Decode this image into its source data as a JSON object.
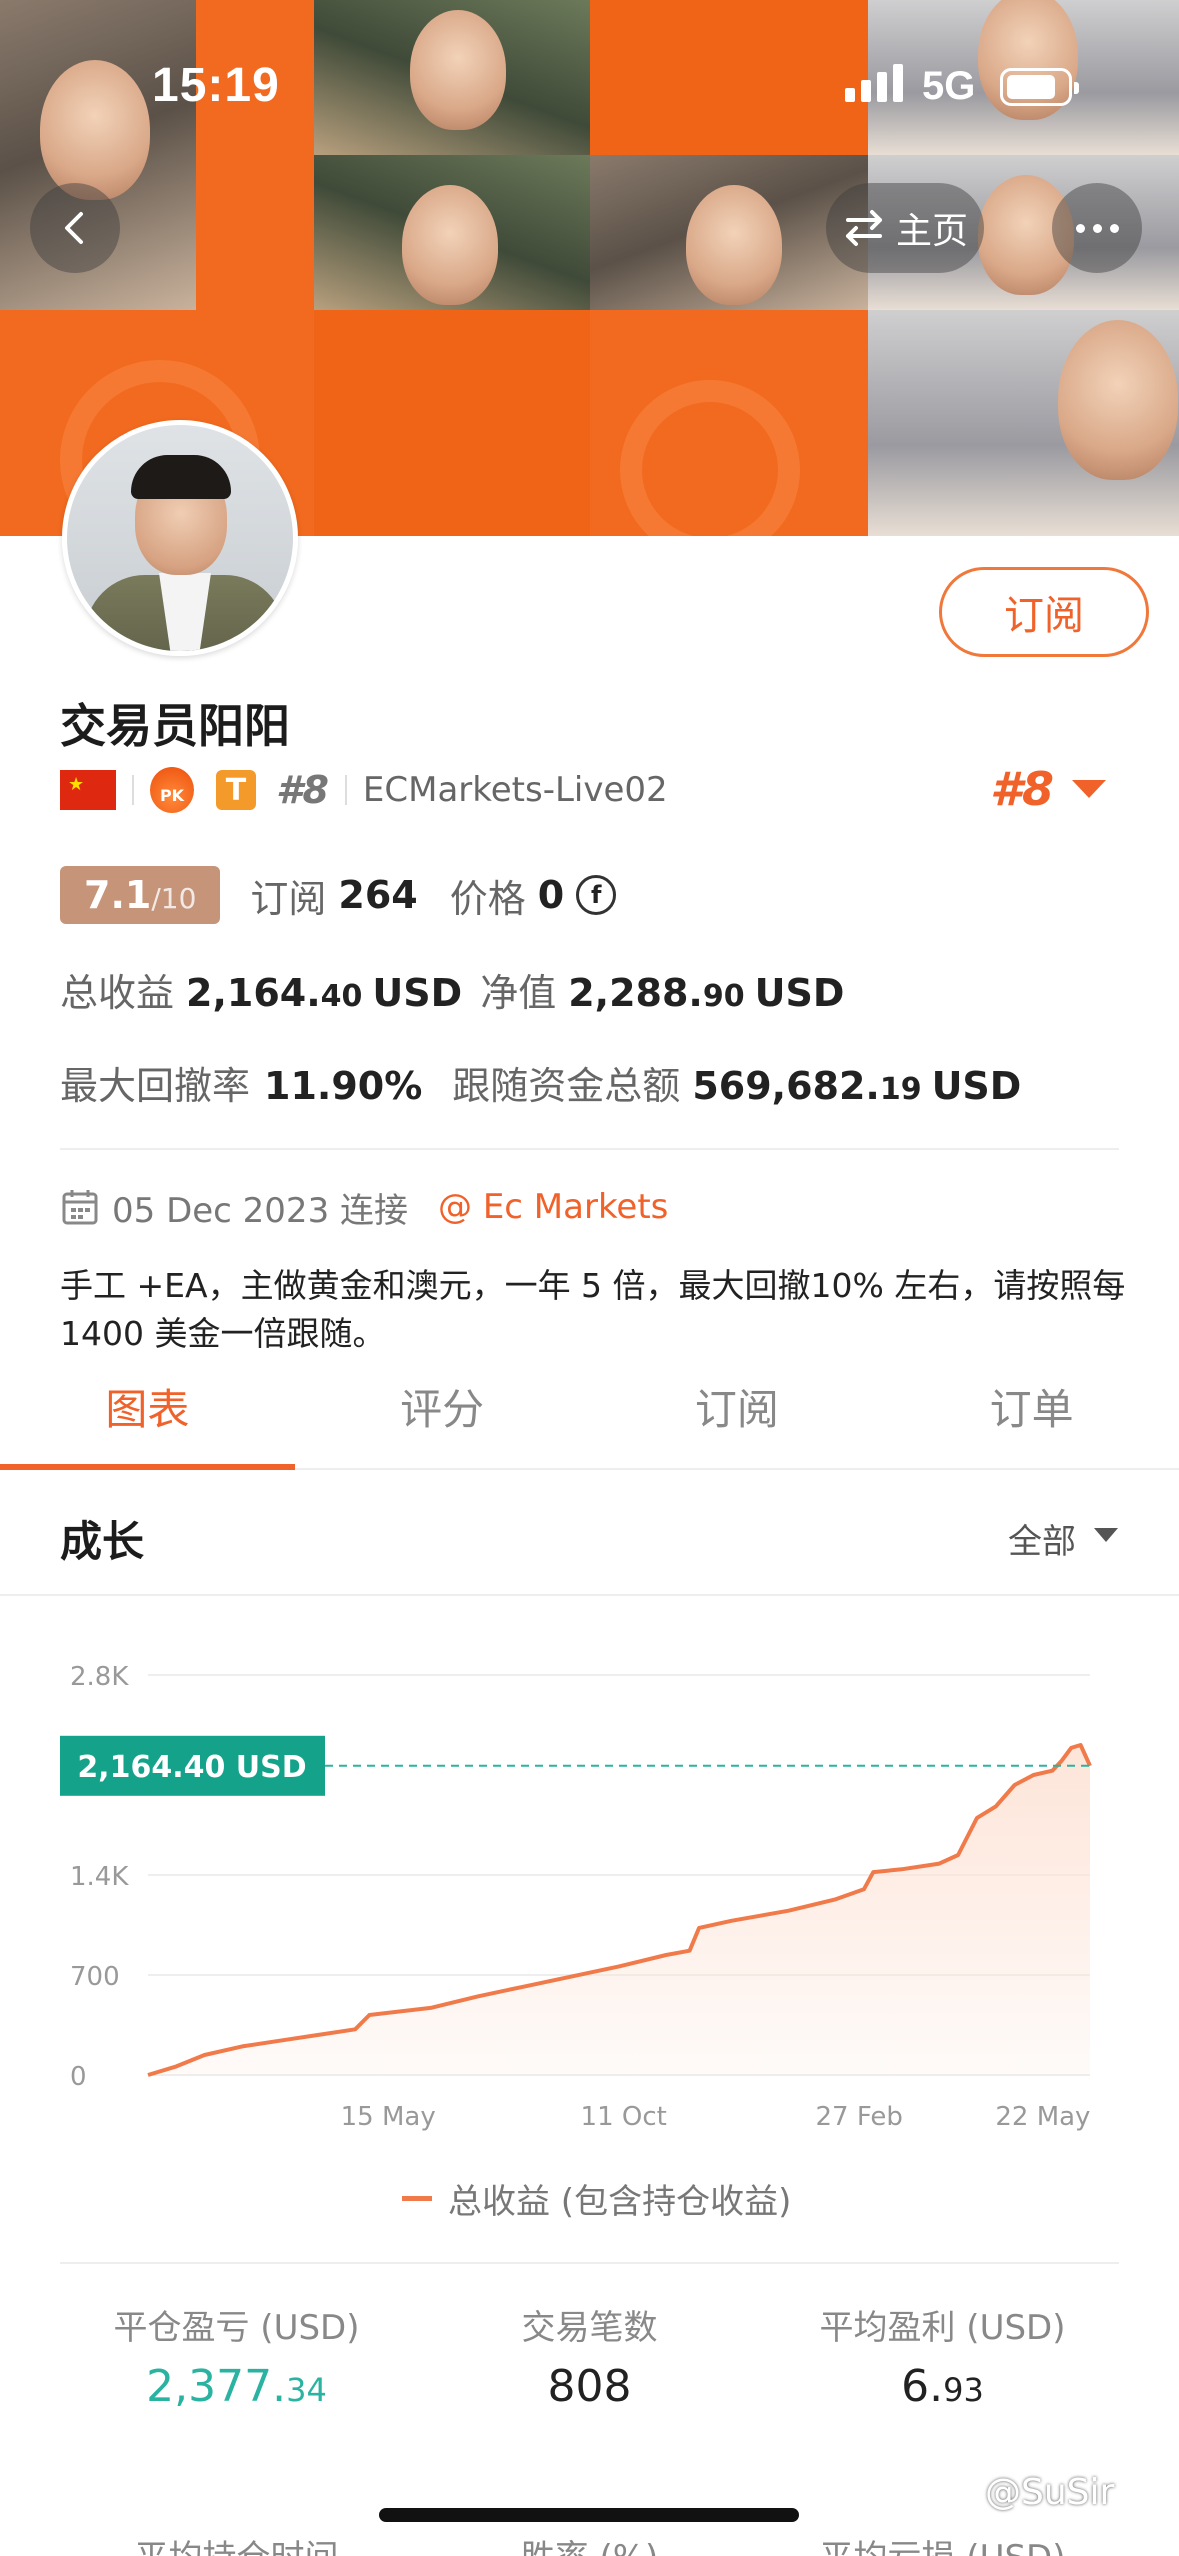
{
  "status_bar": {
    "time": "15:19",
    "network": "5G"
  },
  "nav": {
    "home_label": "主页"
  },
  "profile": {
    "subscribe_label": "订阅",
    "name": "交易员阳阳",
    "rank": "#8",
    "badge_pk": "PK",
    "badge_t": "T",
    "server": "ECMarkets-Live02",
    "score": "7.1",
    "score_max": "/10",
    "subscriptions_label": "订阅",
    "subscriptions": "264",
    "price_label": "价格",
    "price": "0",
    "price_icon": "coin-icon"
  },
  "stats_top": {
    "total_profit_label": "总收益",
    "total_profit_int": "2,164.",
    "total_profit_dec": "40",
    "total_profit_unit": "USD",
    "equity_label": "净值",
    "equity_int": "2,288.",
    "equity_dec": "90",
    "equity_unit": "USD",
    "max_drawdown_label": "最大回撤率",
    "max_drawdown": "11.90%",
    "follow_funds_label": "跟随资金总额",
    "follow_funds_int": "569,682.",
    "follow_funds_dec": "19",
    "follow_funds_unit": "USD"
  },
  "joined": {
    "date": "05 Dec 2023 连接",
    "broker": "@ Ec Markets"
  },
  "description": "手工 +EA，主做黄金和澳元，一年 5 倍，最大回撤10% 左右，请按照每1400 美金一倍跟随。",
  "tabs": [
    {
      "label": "图表",
      "active": true
    },
    {
      "label": "评分",
      "active": false
    },
    {
      "label": "订阅",
      "active": false
    },
    {
      "label": "订单",
      "active": false
    }
  ],
  "section": {
    "title": "成长",
    "range": "全部"
  },
  "chart_data": {
    "type": "area",
    "y_tick_labels": [
      "0",
      "700",
      "1.4K",
      "2.8K"
    ],
    "y_ticks": [
      0,
      700,
      1400,
      2800
    ],
    "ylim": [
      0,
      2800
    ],
    "x_tick_labels": [
      "15 May",
      "11 Oct",
      "27 Feb",
      "22 May"
    ],
    "x_tick_positions": [
      0.255,
      0.505,
      0.755,
      0.95
    ],
    "current_value_label": "2,164.40 USD",
    "current_value": 2164.4,
    "series": [
      {
        "name": "总收益 (包含持仓收益)",
        "x": [
          0,
          0.03,
          0.06,
          0.1,
          0.14,
          0.18,
          0.22,
          0.235,
          0.3,
          0.35,
          0.4,
          0.45,
          0.5,
          0.55,
          0.575,
          0.585,
          0.62,
          0.68,
          0.73,
          0.76,
          0.77,
          0.8,
          0.84,
          0.86,
          0.88,
          0.9,
          0.92,
          0.94,
          0.96,
          0.97,
          0.98,
          0.99,
          1.0
        ],
        "y": [
          0,
          60,
          140,
          200,
          240,
          280,
          320,
          420,
          470,
          550,
          620,
          690,
          760,
          840,
          870,
          1030,
          1080,
          1150,
          1230,
          1300,
          1420,
          1440,
          1480,
          1540,
          1800,
          1880,
          2030,
          2100,
          2130,
          2200,
          2290,
          2310,
          2164.4
        ]
      }
    ],
    "colors": {
      "line": "#f07a4a",
      "fill": "#fde3d6",
      "label_bg": "#14a38a",
      "dash": "#2ab3a0"
    }
  },
  "stats_grid": [
    {
      "label": "平仓盈亏 (USD)",
      "int": "2,377.",
      "dec": "34",
      "green": true
    },
    {
      "label": "交易笔数",
      "int": "808",
      "dec": "",
      "green": false
    },
    {
      "label": "平均盈利 (USD)",
      "int": "6.",
      "dec": "93",
      "green": false
    },
    {
      "label": "平均持仓时间",
      "int": "",
      "dec": "",
      "green": false
    },
    {
      "label": "胜率 (%)",
      "int": "",
      "dec": "",
      "green": false
    },
    {
      "label": "平均亏损 (USD)",
      "int": "",
      "dec": "",
      "green": false
    }
  ],
  "watermark": "@SuSir"
}
